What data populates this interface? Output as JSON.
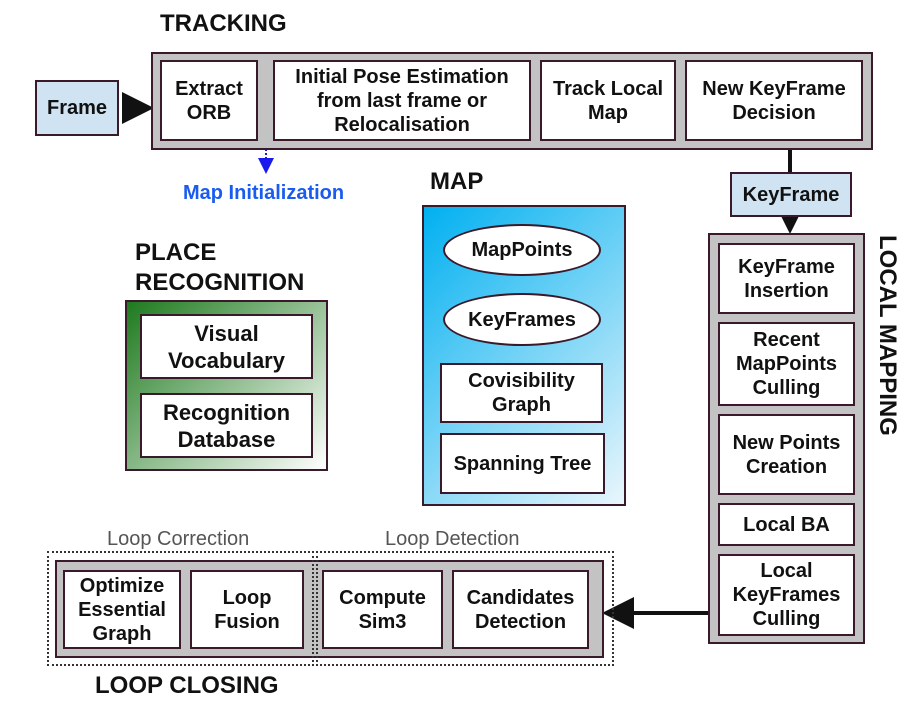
{
  "tracking": {
    "title": "TRACKING",
    "steps": [
      "Extract ORB",
      "Initial Pose Estimation from last frame or Relocalisation",
      "Track Local Map",
      "New KeyFrame Decision"
    ]
  },
  "frame": "Frame",
  "map_initialization": "Map Initialization",
  "keyframe": "KeyFrame",
  "map": {
    "title": "MAP",
    "items": [
      "MapPoints",
      "KeyFrames",
      "Covisibility Graph",
      "Spanning Tree"
    ]
  },
  "place_recognition": {
    "title_line1": "PLACE",
    "title_line2": "RECOGNITION",
    "items": [
      "Visual Vocabulary",
      "Recognition Database"
    ]
  },
  "local_mapping": {
    "title": "LOCAL MAPPING",
    "steps": [
      "KeyFrame Insertion",
      "Recent MapPoints Culling",
      "New Points Creation",
      "Local BA",
      "Local KeyFrames Culling"
    ]
  },
  "loop_closing": {
    "title": "LOOP CLOSING",
    "correction_label": "Loop Correction",
    "detection_label": "Loop Detection",
    "steps": [
      "Optimize Essential Graph",
      "Loop Fusion",
      "Compute Sim3",
      "Candidates Detection"
    ]
  },
  "colors": {
    "frame_fill": "#cfe3f3",
    "group_fill": "#c3c3c3",
    "map_gradient_start": "#00b0f0",
    "map_gradient_end": "#eaf6fc",
    "place_gradient_start": "#1e7a1e",
    "place_gradient_end": "#ffffff",
    "map_init_text": "#1a5cf0"
  }
}
